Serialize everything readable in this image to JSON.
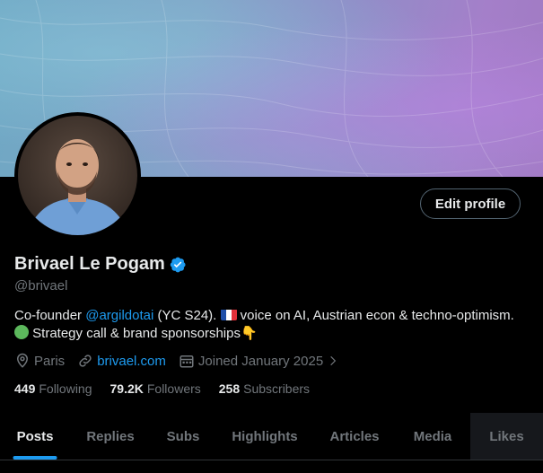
{
  "profile": {
    "display_name": "Brivael Le Pogam",
    "handle": "@brivael",
    "edit_profile_label": "Edit profile",
    "bio": {
      "part1": "Co-founder ",
      "mention": "@argildotai",
      "part2": " (YC S24). ",
      "part3": " voice on AI, Austrian econ & techno-optimism. ",
      "part4": " Strategy call & brand sponsorships",
      "emoji_pointing": "👇"
    },
    "location": "Paris",
    "website": "brivael.com",
    "joined": "Joined January 2025",
    "counts": {
      "following_num": "449",
      "following_label": "Following",
      "followers_num": "79.2K",
      "followers_label": "Followers",
      "subscribers_num": "258",
      "subscribers_label": "Subscribers"
    }
  },
  "tabs": [
    {
      "label": "Posts",
      "active": true
    },
    {
      "label": "Replies",
      "active": false
    },
    {
      "label": "Subs",
      "active": false
    },
    {
      "label": "Highlights",
      "active": false
    },
    {
      "label": "Articles",
      "active": false
    },
    {
      "label": "Media",
      "active": false
    },
    {
      "label": "Likes",
      "active": false
    }
  ],
  "colors": {
    "accent": "#1d9bf0",
    "secondary_text": "#71767b",
    "primary_text": "#e7e9ea",
    "background": "#000000"
  },
  "icons": {
    "verified": "verified-badge-icon",
    "location": "location-pin-icon",
    "link": "link-icon",
    "calendar": "calendar-icon",
    "chevron": "chevron-right-icon"
  }
}
